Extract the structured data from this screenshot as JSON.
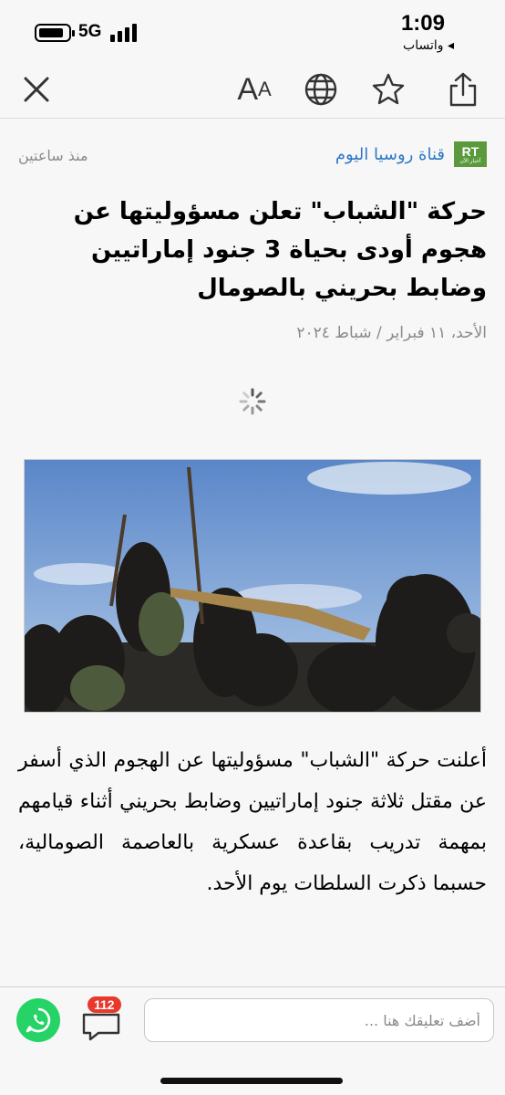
{
  "status_bar": {
    "time": "1:09",
    "network": "5G",
    "back_app": "◂ واتساب"
  },
  "toolbar": {
    "font_size_label_big": "A",
    "font_size_label_small": "A"
  },
  "article": {
    "source_logo_text": "RT",
    "source_logo_sub": "أخبار الآن",
    "source_name": "قناة روسيا اليوم",
    "time_ago": "منذ ساعتين",
    "headline": "حركة \"الشباب\" تعلن مسؤوليتها عن هجوم أودى بحياة 3 جنود إماراتيين وضابط بحريني بالصومال",
    "date": "الأحد، ١١ فبراير / شباط ٢٠٢٤",
    "body": "أعلنت حركة \"الشباب\" مسؤوليتها عن الهجوم الذي أسفر عن مقتل ثلاثة جنود إماراتيين وضابط بحريني أثناء قيامهم بمهمة تدريب بقاعدة عسكرية بالعاصمة الصومالية، حسبما ذكرت السلطات يوم الأحد."
  },
  "bottom_bar": {
    "comment_count": "112",
    "comment_placeholder": "أضف تعليقك هنا ..."
  },
  "colors": {
    "source_link": "#2f78c4",
    "rt_green": "#5a9a3c",
    "whatsapp": "#25d366",
    "badge": "#e8392c"
  }
}
